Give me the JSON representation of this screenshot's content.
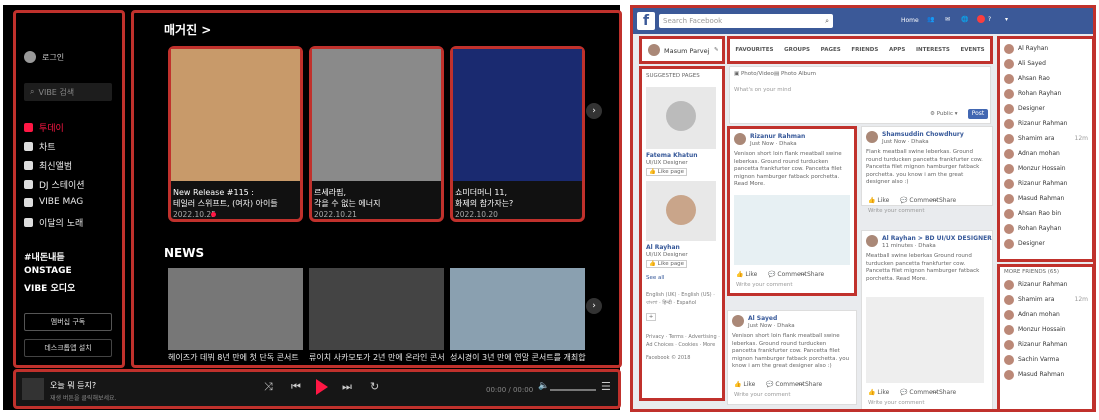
{
  "vibe": {
    "login": "로그인",
    "search_placeholder": "VIBE 검색",
    "nav": [
      {
        "label": "투데이",
        "icon": "home-icon"
      },
      {
        "label": "차트",
        "icon": "trophy-icon"
      },
      {
        "label": "최신앨범",
        "icon": "sparkle-icon"
      },
      {
        "label": "DJ 스테이션",
        "icon": "dj-icon"
      },
      {
        "label": "VIBE MAG",
        "icon": "mag-icon"
      },
      {
        "label": "이달의 노래",
        "icon": "song-icon"
      }
    ],
    "sections": [
      "#내돈내듣",
      "ONSTAGE",
      "VIBE 오디오"
    ],
    "subscribe_btn": "멤버십 구독",
    "desktop_btn": "데스크톱앱 설치",
    "magazine_title": "매거진 >",
    "magazine_cards": [
      {
        "line1": "New Release #115 :",
        "line2": "테일러 스위프트, (여자) 아이들",
        "date": "2022.10.25"
      },
      {
        "line1": "르세라핌,",
        "line2": "각을 수 없는 에너지",
        "date": "2022.10.21"
      },
      {
        "line1": "쇼미더머니 11,",
        "line2": "화제의 참가자는?",
        "date": "2022.10.20"
      }
    ],
    "news_title": "NEWS",
    "news": [
      {
        "text": "헤이즈가 데뷔 8년 만에 첫 단독 콘서트를 개최합니다"
      },
      {
        "text": "류이치 사카모토가 2년 만에 온라인 콘서트를 개최합니다"
      },
      {
        "text": "성시경이 3년 만에 연말 콘서트를 개최합니다"
      }
    ],
    "player": {
      "title": "오늘 뭐 듣지?",
      "subtitle": "재생 버튼을 클릭해보세요.",
      "time": "00:00 / 00:00"
    }
  },
  "fb": {
    "search_placeholder": "Search Facebook",
    "nav_right": [
      "Home"
    ],
    "profile_name": "Masum Parvej",
    "tabs": [
      "FAVOURITES",
      "GROUPS",
      "PAGES",
      "FRIENDS",
      "APPS",
      "INTERESTS",
      "EVENTS"
    ],
    "suggested_title": "SUGGESTED PAGES",
    "suggested": [
      {
        "name": "Fatema Khatun",
        "sub": "UI/UX Designer",
        "btn": "Like page"
      },
      {
        "name": "Al Rayhan",
        "sub": "UI/UX Designer",
        "btn": "Like page"
      }
    ],
    "see_all": "See all",
    "langs": "English (UK) · English (US) · বাংলা · हिन्दी · Español",
    "footer": "Privacy · Terms · Advertising · Ad Choices · Cookies · More",
    "copyright": "Facebook © 2018",
    "composer_tabs": [
      "Photo/Video",
      "Photo Album"
    ],
    "composer_placeholder": "What's on your mind",
    "composer_public": "Public",
    "composer_post": "Post",
    "posts": [
      {
        "name": "Rizanur Rahman",
        "meta": "Just Now · Dhaka",
        "text": "Venison short loin flank meatball swine leberkas. Ground round turducken pancetta frankfurter cow. Pancetta filet mignon hamburger fatback porchetta. Read More."
      },
      {
        "name": "Al Sayed",
        "meta": "Just Now · Dhaka",
        "text": "Venison short loin flank meatball swine leberkas. Ground round turducken pancetta frankfurter cow. Pancetta filet mignon hamburger fatback porchetta. you know i am the great designer also :)"
      },
      {
        "name": "Shamsuddin Chowdhury",
        "meta": "Just Now · Dhaka",
        "text": "Flank meatball swine leberkas. Ground round turducken pancetta frankfurter cow. Pancetta filet mignon hamburger fatback porchetta. you know i am the great designer also :)"
      },
      {
        "name": "Al Rayhan > BD UI/UX DESIGNER",
        "meta": "11 minutes · Dhaka",
        "text": "Meatball swine leberkas Ground round turducken pancetta frankfurter cow. Pancetta filet mignon hamburger fatback porchetta. Read More."
      }
    ],
    "post_actions": [
      "Like",
      "Comment",
      "Share"
    ],
    "comment_placeholder": "Write your comment",
    "right_list": [
      "Al Rayhan",
      "Ali Sayed",
      "Ahsan Rao",
      "Rohan Rayhan",
      "Designer",
      "Rizanur Rahman",
      "Shamim ara",
      "Adnan mohan",
      "Monzur Hossain",
      "Rizanur Rahman",
      "Masud Rahman",
      "Ahsan Rao bin",
      "Rohan Rayhan",
      "Designer"
    ],
    "more_friends": "MORE FRIENDS (65)",
    "right_list2": [
      "Rizanur Rahman",
      "Shamim ara",
      "Adnan mohan",
      "Monzur Hossain",
      "Rizanur Rahman",
      "Sachin Varma",
      "Masud Rahman"
    ],
    "dot_text": "12m",
    "accent": "#3b5998",
    "highlight": "#c0312c"
  }
}
